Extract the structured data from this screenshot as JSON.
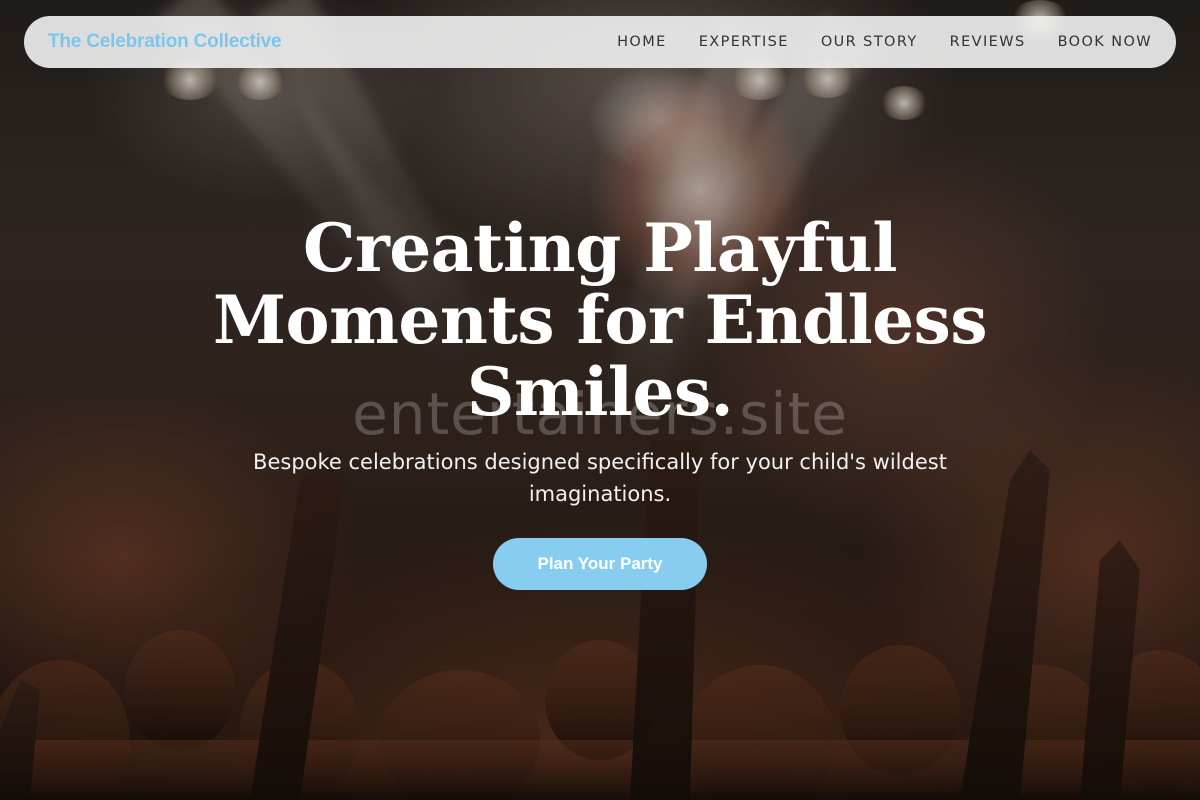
{
  "navbar": {
    "brand": "The Celebration Collective",
    "links": [
      {
        "label": "HOME"
      },
      {
        "label": "EXPERTISE"
      },
      {
        "label": "OUR STORY"
      },
      {
        "label": "REVIEWS"
      },
      {
        "label": "BOOK NOW"
      }
    ]
  },
  "hero": {
    "title": "Creating Playful Moments for Endless Smiles.",
    "subtitle": "Bespoke celebrations designed specifically for your child's wildest imaginations.",
    "cta_label": "Plan Your Party",
    "watermark": "entertainers.site"
  },
  "colors": {
    "brand": "#7cc6ec",
    "cta_background": "#86cdf0",
    "nav_text": "#333333",
    "navbar_background": "#f2f2f2"
  }
}
